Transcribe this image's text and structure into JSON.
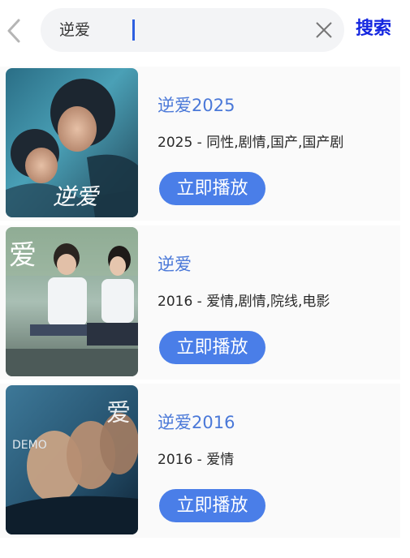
{
  "search": {
    "back_icon": "chevron-left-icon",
    "query": "逆爱",
    "clear_icon": "close-icon",
    "button_label": "搜索"
  },
  "results": [
    {
      "title": "逆爱2025",
      "meta": "2025 - 同性,剧情,国产,国产剧",
      "play_label": "立即播放",
      "poster_text": "逆爱"
    },
    {
      "title": "逆爱",
      "meta": "2016 - 爱情,剧情,院线,电影",
      "play_label": "立即播放",
      "poster_text": "爱"
    },
    {
      "title": "逆爱2016",
      "meta": "2016 - 爱情",
      "play_label": "立即播放",
      "poster_text": "DEMO"
    }
  ],
  "colors": {
    "accent": "#4a7ee8",
    "search_button": "#1426e0",
    "title": "#4a78d8"
  }
}
